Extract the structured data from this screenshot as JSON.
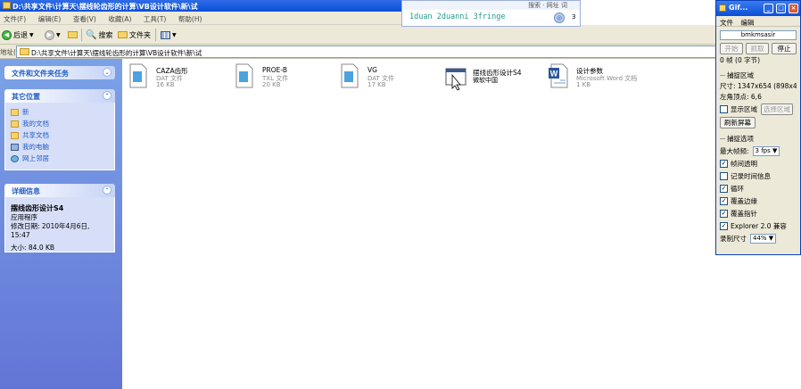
{
  "window": {
    "title": "D:\\共享文件\\计算天\\摆线轮齿形的计算\\VB设计软件\\新\\试"
  },
  "menu": [
    "文件(F)",
    "编辑(E)",
    "查看(V)",
    "收藏(A)",
    "工具(T)",
    "帮助(H)"
  ],
  "toolbar": {
    "back": "后退",
    "search": "搜索",
    "folders": "文件夹"
  },
  "address": {
    "label": "地址(D)",
    "path": "D:\\共享文件\\计算天\\摆线轮齿形的计算\\VB设计软件\\新\\试"
  },
  "tasks": {
    "file_tasks": "文件和文件夹任务",
    "other_places": {
      "title": "其它位置",
      "items": [
        "新",
        "我的文档",
        "共享文档",
        "我的电脑",
        "网上邻居"
      ]
    },
    "details": {
      "title": "详细信息",
      "name": "摆线齿形设计S4",
      "type": "应用程序",
      "modified": "修改日期: 2010年4月6日, 15:47",
      "size": "大小: 84.0 KB"
    }
  },
  "files": [
    {
      "name": "CAZA齿形",
      "type": "DAT 文件",
      "size": "16 KB",
      "icon": "dat-file-icon"
    },
    {
      "name": "PROE-B",
      "type": "TXL 文件",
      "size": "20 KB",
      "icon": "txl-file-icon"
    },
    {
      "name": "VG",
      "type": "DAT 文件",
      "size": "17 KB",
      "icon": "dat-file-icon"
    },
    {
      "name": "摆线齿形设计S4",
      "subname": "微软中国",
      "icon": "application-icon"
    },
    {
      "name": "设计参数",
      "type": "Microsoft Word 文档",
      "size": "1 KB",
      "icon": "word-doc-icon"
    }
  ],
  "search_bar": {
    "top_label": "搜索 · 网址 词",
    "query": "1duan 2duanni 3fringe",
    "extra": "3"
  },
  "gif_window": {
    "title": "Gif...",
    "menu": [
      "文件",
      "编辑"
    ],
    "name_field": "bmkmsasir",
    "buttons": {
      "start": "开始",
      "capture": "抓取",
      "stop": "停止"
    },
    "frames": "0 帧 (0 字节)",
    "capture_area": "捕捉区域",
    "size": "尺寸: 1347x654 (898x436)",
    "corner": "左角顶点:       6,6",
    "show_area": "显示区域",
    "select_area": "选择区域",
    "refresh": "刷新屏幕",
    "capture_options": "捕捉选项",
    "max_fps_label": "最大帧频:",
    "max_fps_value": "3 fps",
    "options": [
      {
        "label": "帧间透明",
        "checked": true
      },
      {
        "label": "记录时间信息",
        "checked": false
      },
      {
        "label": "循环",
        "checked": true
      },
      {
        "label": "覆盖边缘",
        "checked": true
      },
      {
        "label": "覆盖指针",
        "checked": true
      },
      {
        "label": "Explorer 2.0 兼容",
        "checked": true
      }
    ],
    "record_size_label": "录制尺寸",
    "record_size_value": "44%"
  }
}
